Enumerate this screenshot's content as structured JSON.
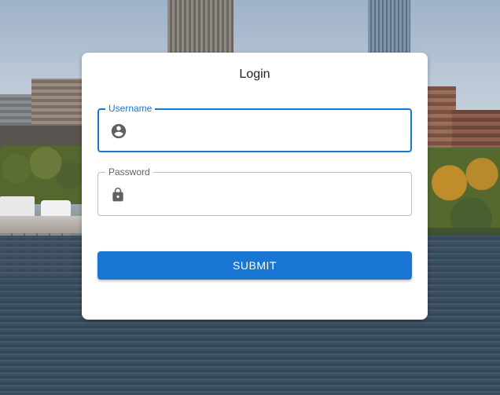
{
  "login": {
    "title": "Login",
    "username": {
      "label": "Username",
      "value": "",
      "icon": "account-circle-icon"
    },
    "password": {
      "label": "Password",
      "value": "",
      "icon": "lock-icon"
    },
    "submit_label": "SUBMIT"
  },
  "colors": {
    "accent": "#1976d2",
    "card_bg": "#ffffff",
    "icon": "#616161",
    "border_default": "#bdbdbd"
  }
}
